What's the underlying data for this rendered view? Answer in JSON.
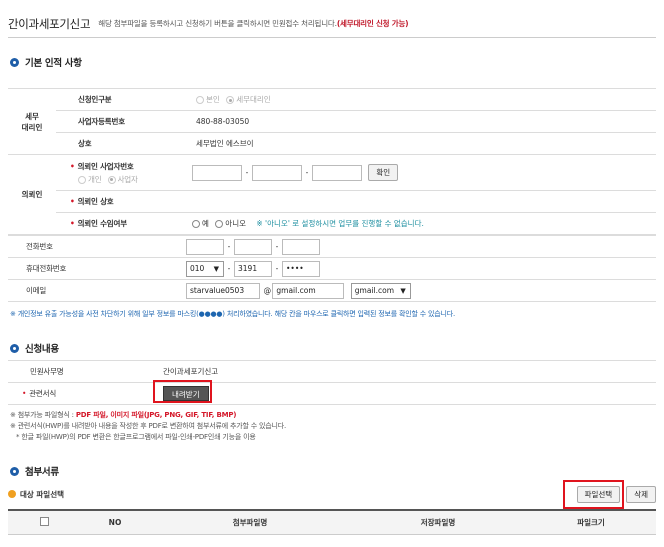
{
  "header": {
    "title": "간이과세포기신고",
    "desc": "해당 첨부파일을 등록하시고 신청하기 버튼을 클릭하시면 민원접수 처리됩니다.",
    "desc_highlight": "(세무대리인 신청 가능)"
  },
  "basic": {
    "section_title": "기본 인적 사항",
    "tax_agent_group": "세무\n대리인",
    "applicant_type_label": "신청인구분",
    "applicant_type_options": [
      "본인",
      "세무대리인"
    ],
    "biz_reg_no_label": "사업자등록번호",
    "biz_reg_no_value": "480-88-03050",
    "company_label": "상호",
    "company_value": "세무법인 에스브이",
    "client_group": "의뢰인",
    "client_biz_no_label": "의뢰인 사업자번호",
    "client_type_options": [
      "개인",
      "사업자"
    ],
    "confirm_label": "확인",
    "client_company_label": "의뢰인 상호",
    "client_consent_label": "의뢰인 수임여부",
    "consent_yes": "예",
    "consent_no": "아니오",
    "consent_note": "※ '아니오' 로 설정하시면 업무를 진행할 수 없습니다."
  },
  "contact": {
    "phone_label": "전화번호",
    "mobile_label": "휴대전화번호",
    "mobile_prefix": "010",
    "mobile_mid": "3191",
    "mobile_last": "••••",
    "email_label": "이메일",
    "email_id": "starvalue0503",
    "at": "@",
    "email_domain": "gmail.com",
    "email_domain_select": "gmail.com",
    "privacy_note": "※ 개인정보 유출 가능성을 사전 차단하기 위해 일부 정보를 마스킹(●●●●) 처리하였습니다. 해당 칸을 마우스로 클릭하면 입력된 정보를 확인할 수 있습니다."
  },
  "apply": {
    "section_title": "신청내용",
    "service_label": "민원사무명",
    "service_value": "간이과세포기신고",
    "form_label": "관련서식",
    "download_label": "내려받기",
    "note1_prefix": "※ 첨부가능 파일형식 : ",
    "note1_red": "PDF 파일, 이미지 파일(JPG, PNG, GIF, TIF, BMP)",
    "note2": "※ 관련서식(HWP)를 내려받아 내용을 작성한 후 PDF로 변환하여 첨부서류에 추가할 수 있습니다.",
    "note3": "* 한글 파일(HWP)의 PDF 변환은 한글프로그램에서 파일-인쇄-PDF인쇄 기능을 이용"
  },
  "attach": {
    "section_title": "첨부서류",
    "target_label": "대상 파일선택",
    "select_file_label": "파일선택",
    "delete_label": "삭제",
    "columns": [
      "NO",
      "첨부파일명",
      "저장파일명",
      "파일크기"
    ]
  },
  "colors": {
    "accent_blue": "#1f5ea8",
    "highlight_red": "#e0141e",
    "required_red": "#d4182a"
  }
}
